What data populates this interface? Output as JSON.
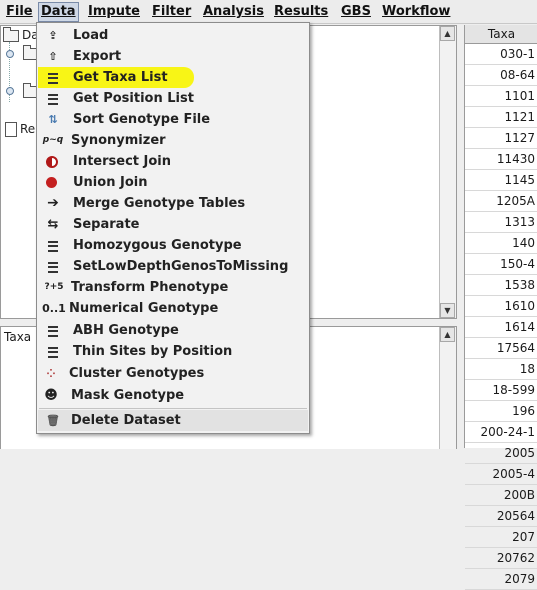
{
  "menubar": {
    "items": [
      "File",
      "Data",
      "Impute",
      "Filter",
      "Analysis",
      "Results",
      "GBS",
      "Workflow"
    ],
    "active": "Data"
  },
  "tree": {
    "nodes": [
      "Da",
      "Re"
    ]
  },
  "bottom_panel": {
    "title": "Taxa"
  },
  "taxa_table": {
    "header": "Taxa",
    "rows": [
      "030-1",
      "08-64",
      "1101",
      "1121",
      "1127",
      "11430",
      "1145",
      "1205A",
      "1313",
      "140",
      "150-4",
      "1538",
      "1610",
      "1614",
      "17564",
      "18",
      "18-599",
      "196",
      "200-24-1",
      "2005",
      "2005-4",
      "200B",
      "20564",
      "207",
      "20762",
      "2079"
    ]
  },
  "data_menu": {
    "items": [
      {
        "label": "Load",
        "icon": "folder-upload-icon"
      },
      {
        "label": "Export",
        "icon": "export-icon"
      },
      {
        "label": "Get Taxa List",
        "icon": "list-icon",
        "highlighted": true
      },
      {
        "label": "Get Position List",
        "icon": "list-icon"
      },
      {
        "label": "Sort Genotype File",
        "icon": "sort-icon"
      },
      {
        "label": "Synonymizer",
        "icon": "synonym-icon"
      },
      {
        "label": "Intersect Join",
        "icon": "intersect-icon"
      },
      {
        "label": "Union Join",
        "icon": "union-icon"
      },
      {
        "label": "Merge Genotype Tables",
        "icon": "merge-icon"
      },
      {
        "label": "Separate",
        "icon": "separate-icon"
      },
      {
        "label": "Homozygous Genotype",
        "icon": "list-icon"
      },
      {
        "label": "SetLowDepthGenosToMissing",
        "icon": "list-icon"
      },
      {
        "label": "Transform Phenotype",
        "icon": "transform-icon"
      },
      {
        "label": "Numerical Genotype",
        "icon": "numeric-icon"
      },
      {
        "label": "ABH Genotype",
        "icon": "list-icon"
      },
      {
        "label": "Thin Sites by Position",
        "icon": "list-icon"
      },
      {
        "label": "Cluster Genotypes",
        "icon": "cluster-icon"
      },
      {
        "label": "Mask Genotype",
        "icon": "mask-icon"
      },
      {
        "label": "Delete Dataset",
        "icon": "trash-icon"
      }
    ],
    "icon_glyphs": {
      "numeric": "0..1",
      "transform": "?+5",
      "synonym": "p~q"
    }
  },
  "colors": {
    "highlight": "#f8f516",
    "menu_background": "#f2f2f2"
  }
}
